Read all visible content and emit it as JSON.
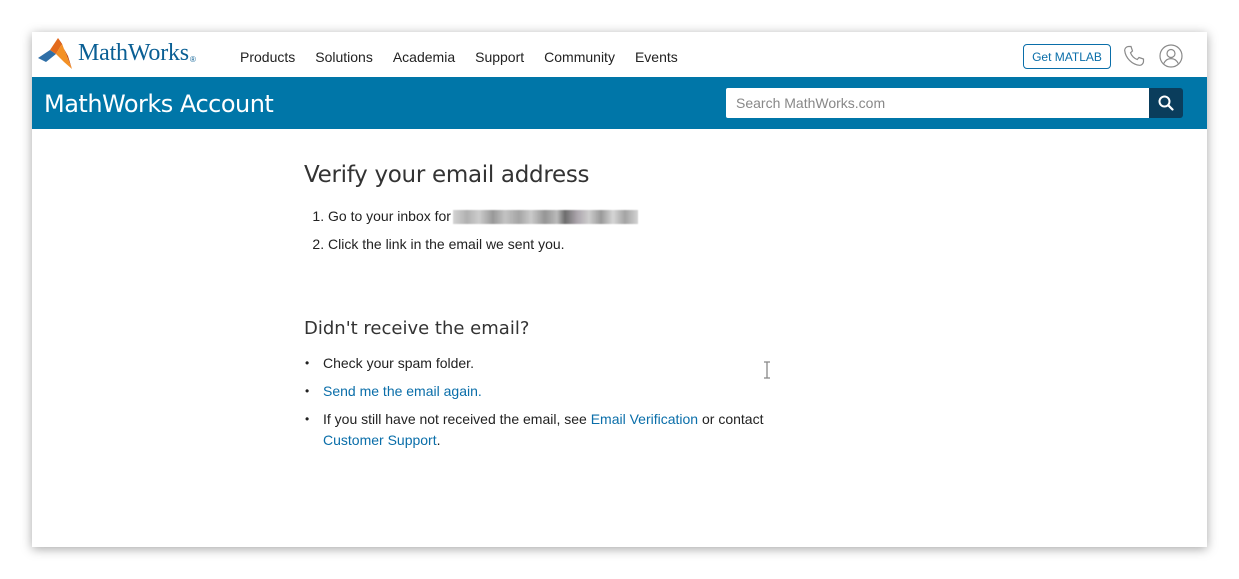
{
  "brand": {
    "logo_text": "MathWorks",
    "registered_mark": "®"
  },
  "nav": {
    "items": [
      "Products",
      "Solutions",
      "Academia",
      "Support",
      "Community",
      "Events"
    ],
    "get_matlab_label": "Get MATLAB"
  },
  "header": {
    "title": "MathWorks Account",
    "search_placeholder": "Search MathWorks.com"
  },
  "verify": {
    "title": "Verify your email address",
    "step1_prefix": "Go to your inbox for",
    "step2": "Click the link in the email we sent you."
  },
  "help": {
    "title": "Didn't receive the email?",
    "tip_spam": "Check your spam folder.",
    "tip_resend_link": "Send me the email again.",
    "tip_support_prefix": "If you still have not received the email, see ",
    "tip_support_link1": "Email Verification",
    "tip_support_middle": " or contact",
    "tip_support_link2": "Customer Support",
    "tip_support_suffix": "."
  },
  "colors": {
    "brand_blue": "#0076a8",
    "link_blue": "#0a6ea9",
    "search_button": "#0a3d5c"
  },
  "icons": {
    "logo": "membrane-logo-icon",
    "phone": "phone-icon",
    "user": "user-icon",
    "search": "search-icon",
    "cursor": "text-cursor-icon"
  }
}
